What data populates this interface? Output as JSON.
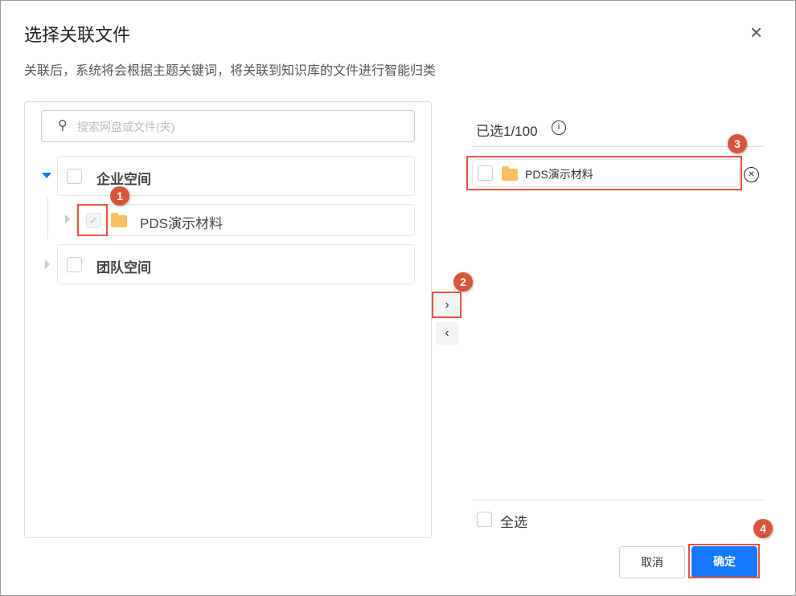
{
  "dialog": {
    "title": "选择关联文件",
    "description": "关联后，系统将会根据主题关键词，将关联到知识库的文件进行智能归类",
    "close_icon": "×"
  },
  "left": {
    "search_placeholder": "搜索网盘或文件(夹)",
    "tree": [
      {
        "label": "企业空间",
        "expanded": true,
        "children": [
          {
            "label": "PDS演示材料",
            "checked": true,
            "disabled": true
          }
        ]
      },
      {
        "label": "团队空间",
        "expanded": false
      }
    ]
  },
  "transfer": {
    "right_arrow": "›",
    "left_arrow": "‹"
  },
  "right": {
    "selected_count": "已选1/100",
    "items": [
      {
        "label": "PDS演示材料"
      }
    ],
    "select_all": "全选"
  },
  "footer": {
    "cancel": "取消",
    "confirm": "确定"
  },
  "annotations": [
    "1",
    "2",
    "3",
    "4"
  ],
  "colors": {
    "primary": "#1677ff",
    "annotation": "#e8533b",
    "folder": "#fdc061"
  }
}
